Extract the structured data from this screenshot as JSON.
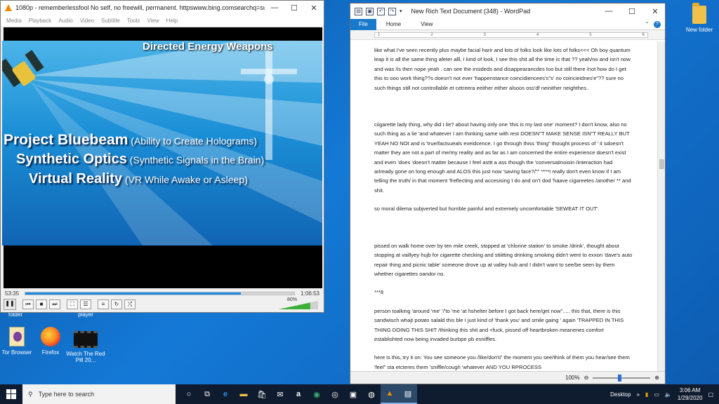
{
  "desktop": {
    "icons": [
      {
        "label": "New folder"
      },
      {
        "label": "folder"
      },
      {
        "label": "player"
      },
      {
        "label": "Tor Browser"
      },
      {
        "label": "Firefox"
      },
      {
        "label": "Watch The Red Pill 20..."
      }
    ]
  },
  "vlc": {
    "title": "1080p - rememberlessfool No self, no freewill, permanent. httpswww.bing.comsearchq=subliminals&...",
    "menu": [
      "Media",
      "Playback",
      "Audio",
      "Video",
      "Subtitle",
      "Tools",
      "View",
      "Help"
    ],
    "video": {
      "top_text": "Directed Energy Weapons",
      "lines": [
        {
          "main": "Project Bluebeam",
          "sub": " (Ability to Create Holograms)"
        },
        {
          "main": "Synthetic Optics",
          "sub": " (Synthetic Signals in the Brain)"
        },
        {
          "main": "Virtual Reality",
          "sub": " (VR While Awake or Asleep)"
        }
      ]
    },
    "time_elapsed": "53:35",
    "time_total": "1:06:53",
    "progress": 0.8,
    "volume_label": "80%",
    "volume": 0.8
  },
  "wordpad": {
    "title": "New Rich Text Document (348) - WordPad",
    "tabs": {
      "file": "File",
      "home": "Home",
      "view": "View"
    },
    "ruler": [
      "1",
      "2",
      "3",
      "4",
      "5",
      "6"
    ],
    "paragraphs": [
      "like what I've seen recently plus maybe facial harir and lots of folks look like lots of folks<<< Oh boy quantum leap it is all the same thing afeter alll, I kind of look, I see this shit all the time is that ?? yeah/no and isn't now and was /is then nope yeah . can see the insideds and disappearancdes too but still there /not how do I get this to ooo work thing??s doesn't not ever 'happenstance coincidiencees's\"s' no coincieidnes'e\"?? sure no such things still not controllable et cetreera eeither either alsoos oss'df neinither neighthes..",
      "ciigarette lady thing, why did I lie? about having only one 'this is my last one' moment? I don't know, also no such thing as a lie 'and whatever I am thinking same with rest DOESN\"T MAKE SENSE ISN\"T REALLY BUT YEAH NO NOt and is 'true/factsueals eveidcence. I go through thiss 'thing\" thought process of ' it sdoesn't matter they are not a part of me/my reality and as far as I am concerned the entire experience doesn't exist and even 'does 'doesn't matter because I feel asttt a ass though the 'conversatinoioin /interaction had arlready gone on long enough and ALOS this just now 'saving face?/\"\" ****I really don't even know if I am telling the truth/ in that moment 'freflecting and accesising I do and on't dod 'haave cigareetes /another ** and shit.",
      "so moral dilema subjverted but horrible painful and extremely uncomfortable 'SEWEAT IT OUT'.",
      "pissed on walk home over by ten mile creek, stopped at 'chlorine station' to smoke /drink', thought about stopping at vaillyey hujb for cigarette checking and stiiitting drinking smoking didn't went to exxon 'dave's auto repair thing and picnic table' someone drove up at valley hub and I didn't want to see/be seen by them whether cigarettes oandor no.",
      "***8",
      "person toalking 'around 'me' '/'to 'me 'at hshelter before I got back here/get now\"..... this that, there is this sandwisch whajt potato salald this ble I just kind of 'thank you' and smile gaing ' again 'TRAPPED IN THIS THING DOING THIS SHIT /thinking this shit and <fuck, pissed off heartbroken meanenes comfort establishted now being invaded burbpe pb esniffles.",
      "here is this,:try it on: You see someone you /like/don't/' the moment you see/think of them you hear/see them 'feel\" sta etcteres them 'sniffle/cough 'whatever AND YOU RPROCESS"
    ],
    "zoom": "100%"
  },
  "taskbar": {
    "search_placeholder": "Type here to search",
    "desktop_label": "Desktop",
    "time": "3:06 AM",
    "date": "1/29/2020"
  }
}
